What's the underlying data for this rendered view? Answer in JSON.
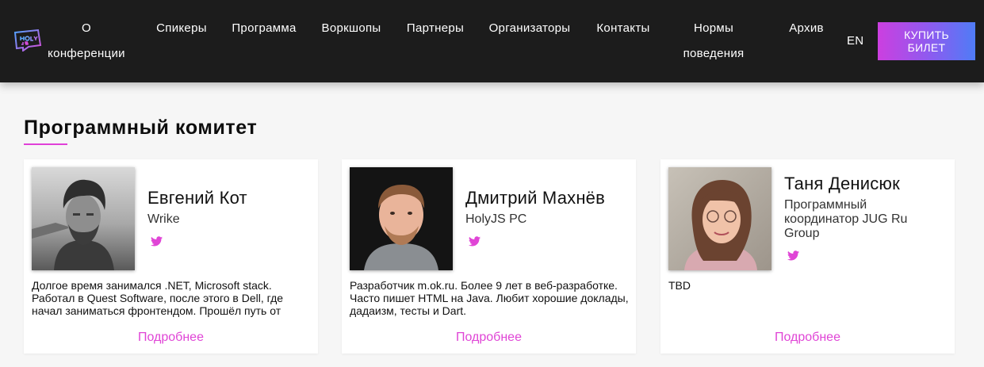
{
  "nav": {
    "items": [
      "О конференции",
      "Спикеры",
      "Программа",
      "Воркшопы",
      "Партнеры",
      "Организаторы",
      "Контакты",
      "Нормы поведения",
      "Архив"
    ],
    "lang": "EN",
    "buy_line1": "КУПИТЬ",
    "buy_line2": "БИЛЕТ"
  },
  "section": {
    "title": "Программный комитет"
  },
  "members": [
    {
      "name": "Евгений Кот",
      "role": "Wrike",
      "bio": "Долгое время занимался .NET, Microsoft stack. Работал в Quest Software, после этого в Dell, где начал заниматься фронтендом. Прошёл путь от",
      "more": "Подробнее"
    },
    {
      "name": "Дмитрий Махнёв",
      "role": "HolyJS PC",
      "bio": "Разработчик m.ok.ru. Более 9 лет в веб-разработке. Часто пишет HTML на Java. Любит хорошие доклады, дадаизм, тесты и Dart.",
      "more": "Подробнее"
    },
    {
      "name": "Таня Денисюк",
      "role": "Программный координатор JUG Ru Group",
      "bio": "TBD",
      "more": "Подробнее"
    }
  ],
  "colors": {
    "accent": "#e040d8",
    "header_bg": "#1c1c1c",
    "twitter": "#e045d6"
  }
}
